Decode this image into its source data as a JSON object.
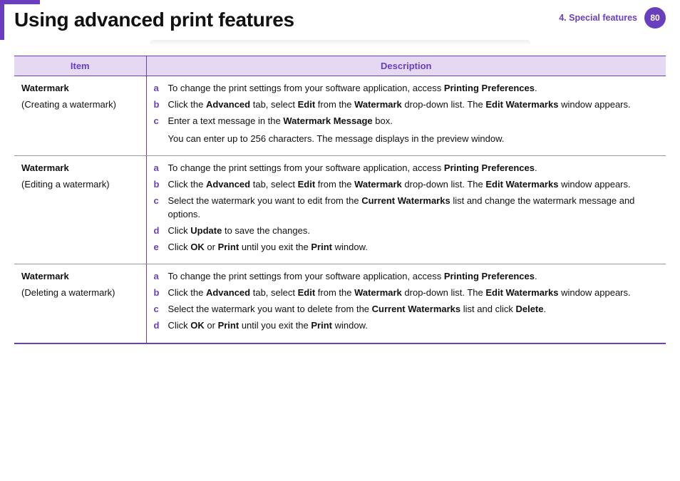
{
  "header": {
    "title": "Using advanced print features",
    "chapter": "4.  Special features",
    "page": "80"
  },
  "table": {
    "headers": {
      "item": "Item",
      "desc": "Description"
    },
    "rows": [
      {
        "item_title": "Watermark",
        "item_sub": "(Creating a watermark)",
        "steps": [
          {
            "m": "a",
            "parts": [
              "To change the print settings from your software application, access ",
              "Printing Preferences",
              "."
            ]
          },
          {
            "m": "b",
            "parts": [
              "Click the ",
              "Advanced",
              " tab, select ",
              "Edit",
              " from the ",
              "Watermark",
              " drop-down list. The ",
              "Edit Watermarks",
              " window appears."
            ]
          },
          {
            "m": "c",
            "parts": [
              "Enter a text message in the ",
              "Watermark Message",
              " box."
            ],
            "extra": "You can enter up to 256 characters. The message displays in the preview window."
          }
        ]
      },
      {
        "item_title": "Watermark",
        "item_sub": "(Editing a watermark)",
        "steps": [
          {
            "m": "a",
            "parts": [
              "To change the print settings from your software application, access ",
              "Printing Preferences",
              "."
            ]
          },
          {
            "m": "b",
            "parts": [
              "Click the ",
              "Advanced",
              " tab, select ",
              "Edit",
              " from the ",
              "Watermark",
              " drop-down list. The ",
              "Edit Watermarks",
              " window appears."
            ]
          },
          {
            "m": "c",
            "parts": [
              "Select the watermark you want to edit from the ",
              "Current Watermarks",
              " list and change the watermark message and options."
            ]
          },
          {
            "m": "d",
            "parts": [
              "Click ",
              "Update",
              " to save the changes."
            ]
          },
          {
            "m": "e",
            "parts": [
              "Click ",
              "OK",
              " or ",
              "Print",
              " until you exit the ",
              "Print",
              " window."
            ]
          }
        ]
      },
      {
        "item_title": "Watermark",
        "item_sub": "(Deleting a watermark)",
        "steps": [
          {
            "m": "a",
            "parts": [
              "To change the print settings from your software application, access ",
              "Printing Preferences",
              "."
            ]
          },
          {
            "m": "b",
            "parts": [
              "Click the ",
              "Advanced",
              " tab, select ",
              "Edit",
              " from the ",
              "Watermark",
              " drop-down list. The ",
              "Edit Watermarks",
              " window appears."
            ]
          },
          {
            "m": "c",
            "parts": [
              "Select the watermark you want to delete from the ",
              "Current Watermarks",
              " list and click ",
              "Delete",
              "."
            ]
          },
          {
            "m": "d",
            "parts": [
              "Click ",
              "OK",
              " or ",
              "Print",
              " until you exit the ",
              "Print",
              " window."
            ]
          }
        ]
      }
    ]
  }
}
